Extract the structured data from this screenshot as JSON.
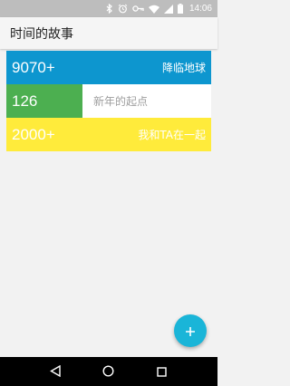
{
  "status_bar": {
    "time": "14:06",
    "icons": [
      "bluetooth-icon",
      "alarm-icon",
      "key-icon",
      "wifi-icon",
      "signal-icon",
      "battery-icon"
    ]
  },
  "app_bar": {
    "title": "时间的故事"
  },
  "cards": [
    {
      "count": "9070+",
      "title": "降临地球",
      "color": "#0d96cf"
    },
    {
      "count": "126",
      "title": "新年的起点",
      "color": "#4caf50"
    },
    {
      "count": "2000+",
      "title": "我和TA在一起",
      "color": "#ffeb3b"
    }
  ],
  "fab": {
    "icon": "plus-icon",
    "color": "#1ab5d8"
  },
  "nav_bar": {
    "icons": [
      "back-icon",
      "home-icon",
      "recents-icon"
    ]
  }
}
